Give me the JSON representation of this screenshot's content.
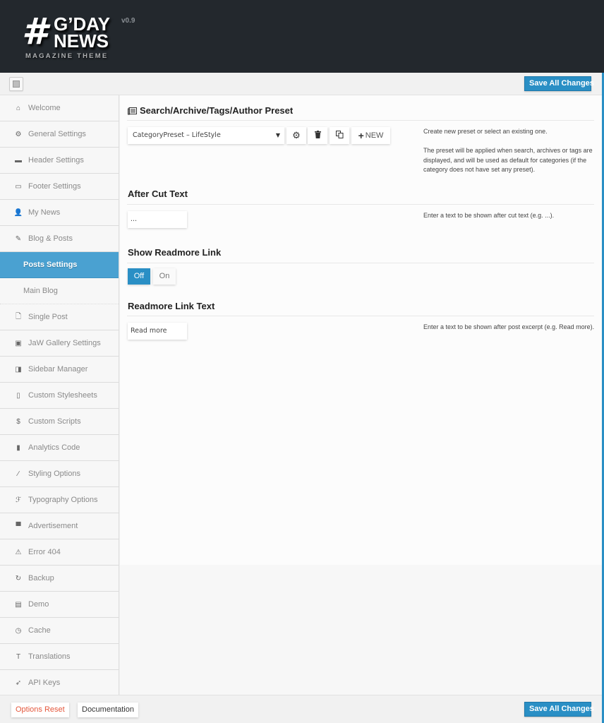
{
  "header": {
    "logo_symbol": "#",
    "logo_line1": "G’DAY",
    "logo_line2": "NEWS",
    "logo_tagline": "MAGAZINE THEME",
    "version": "v0.9"
  },
  "toolbar": {
    "toggle_icon": "sidebar-toggle-icon",
    "save_label": "Save All Changes"
  },
  "sidebar": {
    "items": [
      {
        "label": "Welcome",
        "icon": "home-icon",
        "glyph": "⌂"
      },
      {
        "label": "General Settings",
        "icon": "gear-icon",
        "glyph": "⚙"
      },
      {
        "label": "Header Settings",
        "icon": "header-window-icon",
        "glyph": "▬"
      },
      {
        "label": "Footer Settings",
        "icon": "footer-window-icon",
        "glyph": "▭"
      },
      {
        "label": "My News",
        "icon": "user-icon",
        "glyph": "👤"
      },
      {
        "label": "Blog & Posts",
        "icon": "edit-icon",
        "glyph": "✎"
      },
      {
        "label": "Posts Settings",
        "icon": "",
        "glyph": "",
        "active": true,
        "sub": true
      },
      {
        "label": "Main Blog",
        "icon": "",
        "glyph": "",
        "sub": true
      },
      {
        "label": "Single Post",
        "icon": "file-icon",
        "glyph": "🗋"
      },
      {
        "label": "JaW Gallery Settings",
        "icon": "image-icon",
        "glyph": "▣"
      },
      {
        "label": "Sidebar Manager",
        "icon": "sidebar-icon",
        "glyph": "◨"
      },
      {
        "label": "Custom Stylesheets",
        "icon": "code-file-icon",
        "glyph": "▯"
      },
      {
        "label": "Custom Scripts",
        "icon": "dollar-icon",
        "glyph": "$"
      },
      {
        "label": "Analytics Code",
        "icon": "bar-chart-icon",
        "glyph": "▮"
      },
      {
        "label": "Styling Options",
        "icon": "brush-icon",
        "glyph": "∕"
      },
      {
        "label": "Typography Options",
        "icon": "font-icon",
        "glyph": "ℱ"
      },
      {
        "label": "Advertisement",
        "icon": "ad-layout-icon",
        "glyph": "▀"
      },
      {
        "label": "Error 404",
        "icon": "warning-icon",
        "glyph": "⚠"
      },
      {
        "label": "Backup",
        "icon": "refresh-icon",
        "glyph": "↻"
      },
      {
        "label": "Demo",
        "icon": "archive-icon",
        "glyph": "▤"
      },
      {
        "label": "Cache",
        "icon": "clock-icon",
        "glyph": "◷"
      },
      {
        "label": "Translations",
        "icon": "text-icon",
        "glyph": "T"
      },
      {
        "label": "API Keys",
        "icon": "rocket-icon",
        "glyph": "➶"
      }
    ]
  },
  "main": {
    "preset_section": {
      "title": "Search/Archive/Tags/Author Preset",
      "title_icon": "newspaper-icon",
      "selected_preset": "CategoryPreset – LifeStyle",
      "new_label": "NEW",
      "desc_line1": "Create new preset or select an existing one.",
      "desc_line2": "The preset will be applied when search, archives or tags are displayed, and will be used as default for categories (if the category does not have set any preset)."
    },
    "after_cut": {
      "title": "After Cut Text",
      "value": "...",
      "desc": "Enter a text to be shown after cut text (e.g. ...)."
    },
    "readmore_link": {
      "title": "Show Readmore Link",
      "off_label": "Off",
      "on_label": "On",
      "selected": "Off"
    },
    "readmore_text": {
      "title": "Readmore Link Text",
      "value": "Read more",
      "desc": "Enter a text to be shown after post excerpt (e.g. Read more)."
    }
  },
  "footer": {
    "reset_label": "Options Reset",
    "docs_label": "Documentation",
    "save_label": "Save All Changes"
  },
  "colors": {
    "accent": "#2a8fc5",
    "active_nav": "#4aa1d1",
    "header_bg": "#23282d",
    "reset_text": "#e4573c"
  }
}
